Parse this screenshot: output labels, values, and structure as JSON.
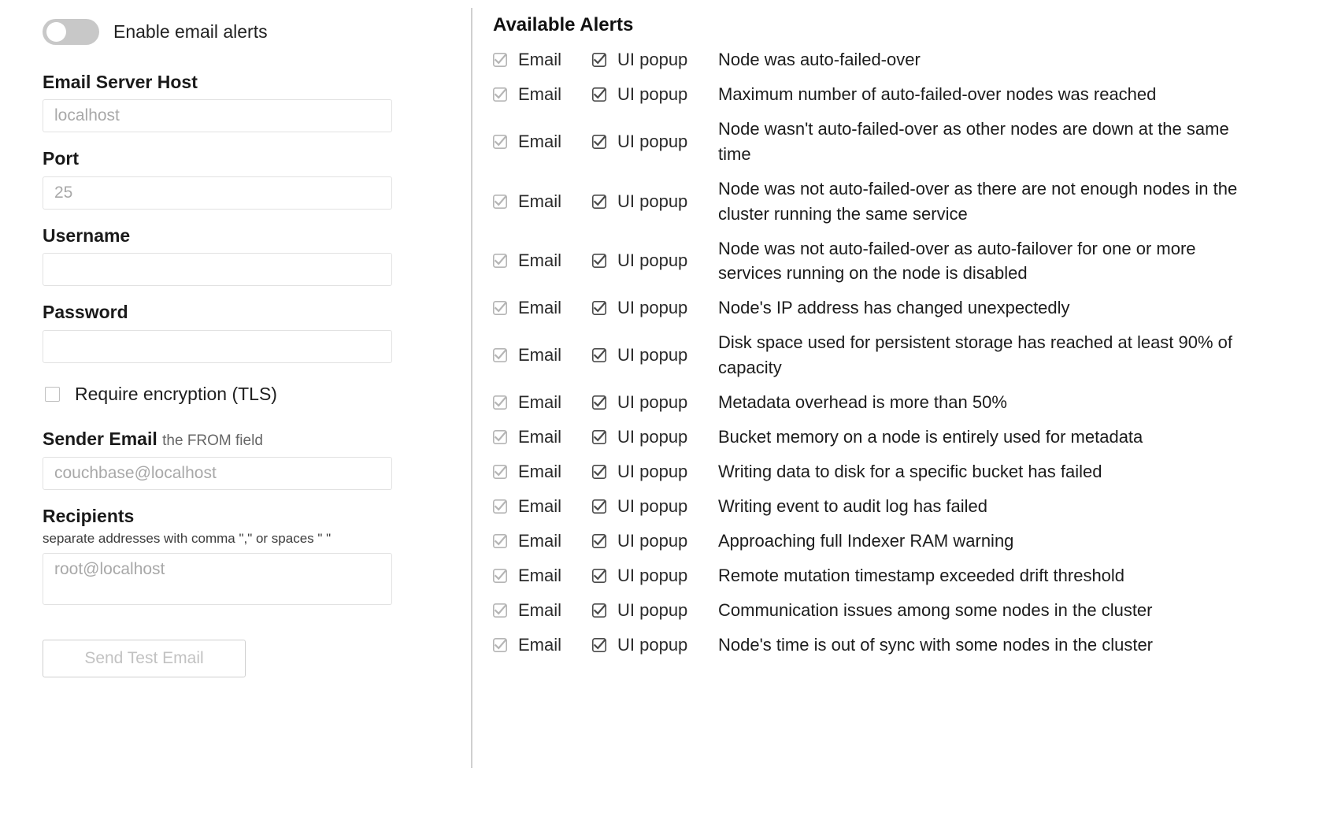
{
  "left": {
    "enable_toggle": {
      "label": "Enable email alerts",
      "state": "off"
    },
    "fields": [
      {
        "label": "Email Server Host",
        "sublabel": "",
        "hint": "",
        "placeholder": "localhost",
        "value": "",
        "type": "input"
      },
      {
        "label": "Port",
        "sublabel": "",
        "hint": "",
        "placeholder": "25",
        "value": "",
        "type": "input"
      },
      {
        "label": "Username",
        "sublabel": "",
        "hint": "",
        "placeholder": "",
        "value": "",
        "type": "input"
      },
      {
        "label": "Password",
        "sublabel": "",
        "hint": "",
        "placeholder": "",
        "value": "",
        "type": "input"
      }
    ],
    "tls_checkbox": {
      "label": "Require encryption (TLS)",
      "checked": false
    },
    "sender": {
      "label": "Sender Email",
      "sublabel": "the FROM field",
      "placeholder": "couchbase@localhost",
      "value": ""
    },
    "recipients": {
      "label": "Recipients",
      "hint": "separate addresses with comma \",\" or spaces \" \"",
      "placeholder": "root@localhost",
      "value": ""
    },
    "send_test_button": {
      "label": "Send Test Email",
      "disabled": true
    }
  },
  "right": {
    "title": "Available Alerts",
    "column_labels": {
      "email": "Email",
      "popup": "UI popup"
    },
    "alerts": [
      {
        "email_checked": true,
        "email_disabled": true,
        "popup_checked": true,
        "popup_disabled": false,
        "description": "Node was auto-failed-over"
      },
      {
        "email_checked": true,
        "email_disabled": true,
        "popup_checked": true,
        "popup_disabled": false,
        "description": "Maximum number of auto-failed-over nodes was reached"
      },
      {
        "email_checked": true,
        "email_disabled": true,
        "popup_checked": true,
        "popup_disabled": false,
        "description": "Node wasn't auto-failed-over as other nodes are down at the same time"
      },
      {
        "email_checked": true,
        "email_disabled": true,
        "popup_checked": true,
        "popup_disabled": false,
        "description": "Node was not auto-failed-over as there are not enough nodes in the cluster running the same service"
      },
      {
        "email_checked": true,
        "email_disabled": true,
        "popup_checked": true,
        "popup_disabled": false,
        "description": "Node was not auto-failed-over as auto-failover for one or more services running on the node is disabled"
      },
      {
        "email_checked": true,
        "email_disabled": true,
        "popup_checked": true,
        "popup_disabled": false,
        "description": "Node's IP address has changed unexpectedly"
      },
      {
        "email_checked": true,
        "email_disabled": true,
        "popup_checked": true,
        "popup_disabled": false,
        "description": "Disk space used for persistent storage has reached at least 90% of capacity"
      },
      {
        "email_checked": true,
        "email_disabled": true,
        "popup_checked": true,
        "popup_disabled": false,
        "description": "Metadata overhead is more than 50%"
      },
      {
        "email_checked": true,
        "email_disabled": true,
        "popup_checked": true,
        "popup_disabled": false,
        "description": "Bucket memory on a node is entirely used for metadata"
      },
      {
        "email_checked": true,
        "email_disabled": true,
        "popup_checked": true,
        "popup_disabled": false,
        "description": "Writing data to disk for a specific bucket has failed"
      },
      {
        "email_checked": true,
        "email_disabled": true,
        "popup_checked": true,
        "popup_disabled": false,
        "description": "Writing event to audit log has failed"
      },
      {
        "email_checked": true,
        "email_disabled": true,
        "popup_checked": true,
        "popup_disabled": false,
        "description": "Approaching full Indexer RAM warning"
      },
      {
        "email_checked": true,
        "email_disabled": true,
        "popup_checked": true,
        "popup_disabled": false,
        "description": "Remote mutation timestamp exceeded drift threshold"
      },
      {
        "email_checked": true,
        "email_disabled": true,
        "popup_checked": true,
        "popup_disabled": false,
        "description": "Communication issues among some nodes in the cluster"
      },
      {
        "email_checked": true,
        "email_disabled": true,
        "popup_checked": true,
        "popup_disabled": false,
        "description": "Node's time is out of sync with some nodes in the cluster"
      }
    ]
  },
  "colors": {
    "checkbox_active": "#4a4a4a",
    "checkbox_disabled": "#b5b5b5",
    "border": "#e2e2e2",
    "divider": "#d0d0d0",
    "placeholder": "#a8a8a8",
    "toggle_off": "#c8c8c8"
  }
}
